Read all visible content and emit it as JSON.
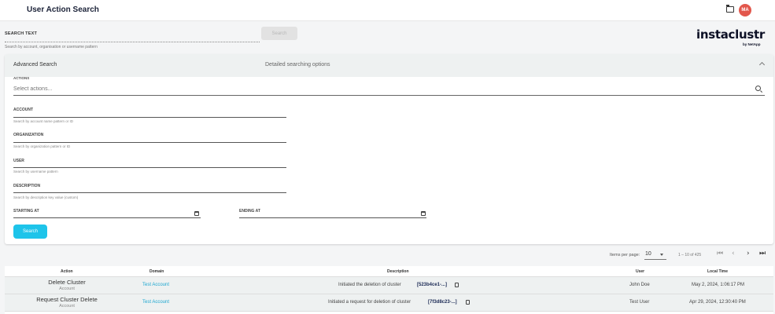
{
  "header": {
    "title": "User Action Search",
    "avatar_initials": "MA",
    "folder_icon": "folder-icon"
  },
  "search_text": {
    "label": "SEARCH TEXT",
    "hint": "Search by account, organisation or username pattern",
    "button": "Search"
  },
  "logo": {
    "name": "instaclustr",
    "sub": "by NetApp"
  },
  "advanced": {
    "title": "Advanced Search",
    "description": "Detailed searching options",
    "actions_label": "ACTIONS",
    "actions_placeholder": "Select actions...",
    "fields": [
      {
        "label": "ACCOUNT",
        "hint": "Search by account name pattern or ID"
      },
      {
        "label": "ORGANIZATION",
        "hint": "Search by organization pattern or ID"
      },
      {
        "label": "USER",
        "hint": "Search by username pattern"
      },
      {
        "label": "DESCRIPTION",
        "hint": "Search by description key value (custom)"
      }
    ],
    "starting_at": "STARTING AT",
    "ending_at": "ENDING AT",
    "search_button": "Search"
  },
  "pagination": {
    "items_per_page_label": "Items per page:",
    "items_per_page": "10",
    "range": "1 – 10 of 425"
  },
  "table": {
    "headers": [
      "Action",
      "Domain",
      "Description",
      "User",
      "Local Time"
    ],
    "rows": [
      {
        "action": "Delete Cluster",
        "action_sub": "Account",
        "domain": "Test Account",
        "description": "Initiated the deletion of cluster",
        "cluster_id": "[523b4ce1-...]",
        "user": "John Doe",
        "time": "May 2, 2024, 1:06:17 PM"
      },
      {
        "action": "Request Cluster Delete",
        "action_sub": "Account",
        "domain": "Test Account",
        "description": "Initiated a request for deletion of cluster",
        "cluster_id": "[7f3d8c23-...]",
        "user": "Test User",
        "time": "Apr 29, 2024, 12:30:40 PM"
      }
    ]
  },
  "colors": {
    "accent": "#1ec4ea",
    "avatar": "#e2574c",
    "link": "#1ea7d0"
  }
}
